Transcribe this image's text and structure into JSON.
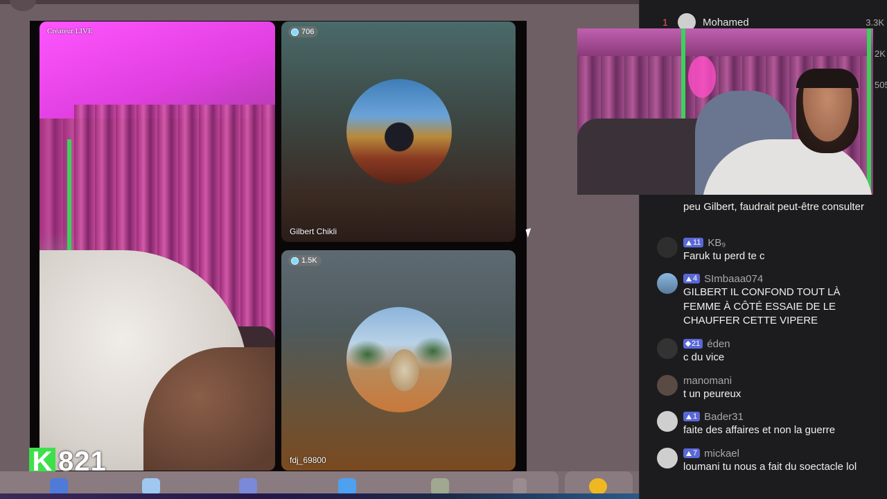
{
  "stage": {
    "host_tile": {
      "label": "Créateur LIVE"
    },
    "guest_tiles": [
      {
        "viewers": "706",
        "name": "Gilbert Chikli"
      },
      {
        "viewers": "1.5K",
        "name": "fdj_69800"
      }
    ],
    "score": {
      "badge": "K",
      "value": "821"
    }
  },
  "leaderboard": {
    "top_entry": {
      "rank": "1",
      "name": "Mohamed",
      "score": "3.3K"
    },
    "edge_values": [
      "2K",
      "505"
    ]
  },
  "chat": {
    "partial_message": "peu Gilbert, faudrait peut-être consulter",
    "messages": [
      {
        "level": "11",
        "username": "KB₉",
        "text": "Faruk tu perd te c"
      },
      {
        "level": "4",
        "username": "SImbaaa074",
        "text": "GILBERT IL CONFOND TOUT LÀ FEMME À CÔTÉ ESSAIE DE LE CHAUFFER CETTE VIPERE"
      },
      {
        "level": "21",
        "username": "éden",
        "text": "c du vice"
      },
      {
        "level": "",
        "username": "manomani",
        "text": "t un peureux"
      },
      {
        "level": "1",
        "username": "Bader31",
        "text": "faite des affaires et non la guerre"
      },
      {
        "level": "7",
        "username": "mickael",
        "text": "loumani tu nous a fait du soectacle lol"
      }
    ]
  },
  "colors": {
    "chat_bg": "#1c1c1e",
    "level_badge": "#5a68d6",
    "score_green": "#3ee04a",
    "rank_red": "#ff4d6a"
  }
}
